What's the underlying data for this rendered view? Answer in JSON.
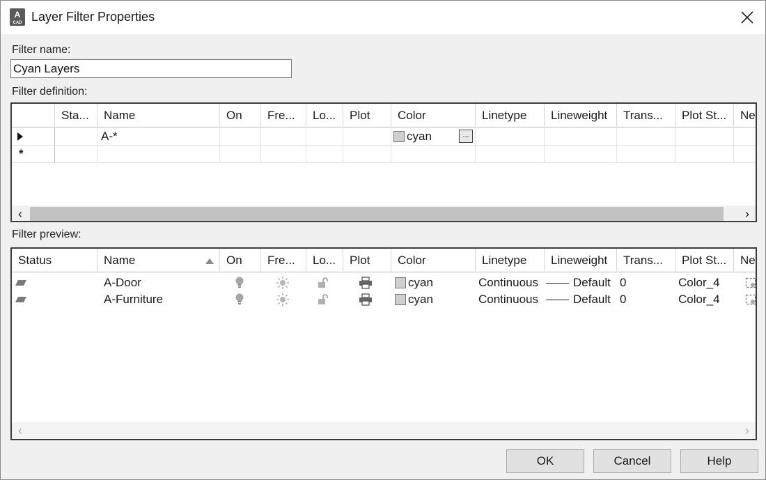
{
  "window": {
    "title": "Layer Filter Properties",
    "icon_letter": "A",
    "icon_sub": "CAD"
  },
  "filter_name": {
    "label": "Filter name:",
    "value": "Cyan Layers"
  },
  "filter_definition": {
    "label": "Filter definition:",
    "columns": [
      "Sta...",
      "Name",
      "On",
      "Fre...",
      "Lo...",
      "Plot",
      "Color",
      "Linetype",
      "Lineweight",
      "Trans...",
      "Plot St...",
      "Ne..."
    ],
    "rows": [
      {
        "marker": "current-row-arrow",
        "name": "A-*",
        "color": "cyan"
      },
      {
        "marker": "*"
      }
    ]
  },
  "filter_preview": {
    "label": "Filter preview:",
    "columns": [
      "Status",
      "Name",
      "On",
      "Fre...",
      "Lo...",
      "Plot",
      "Color",
      "Linetype",
      "Lineweight",
      "Trans...",
      "Plot St...",
      "Ne..."
    ],
    "sorted_column": "Name",
    "rows": [
      {
        "name": "A-Door",
        "color": "cyan",
        "linetype": "Continuous",
        "lineweight": "Default",
        "transparency": "0",
        "plot_style": "Color_4"
      },
      {
        "name": "A-Furniture",
        "color": "cyan",
        "linetype": "Continuous",
        "lineweight": "Default",
        "transparency": "0",
        "plot_style": "Color_4"
      }
    ]
  },
  "buttons": {
    "ok": "OK",
    "cancel": "Cancel",
    "help": "Help"
  },
  "colors": {
    "swatch": "#cfcfcf",
    "grid_border": "#3c3c3c",
    "dialog_bg": "#f0f0f0"
  }
}
